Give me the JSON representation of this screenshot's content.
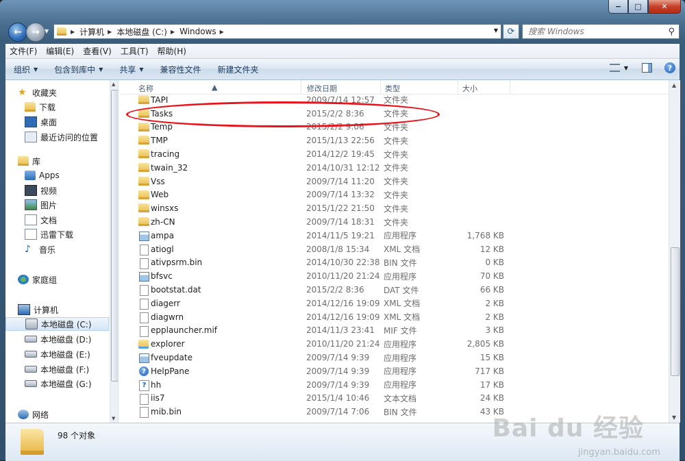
{
  "window": {
    "caption": {
      "minimize": "−",
      "maximize": "□",
      "close": "✕"
    }
  },
  "address": {
    "segments": [
      "计算机",
      "本地磁盘 (C:)",
      "Windows"
    ],
    "search_placeholder": "搜索 Windows"
  },
  "menu": [
    "文件(F)",
    "编辑(E)",
    "查看(V)",
    "工具(T)",
    "帮助(H)"
  ],
  "toolbar": {
    "organize": "组织",
    "include_library": "包含到库中",
    "share": "共享",
    "compat_files": "兼容性文件",
    "new_folder": "新建文件夹"
  },
  "columns": {
    "name": "名称",
    "date": "修改日期",
    "type": "类型",
    "size": "大小"
  },
  "nav": {
    "favorites": "收藏夹",
    "downloads": "下载",
    "desktop": "桌面",
    "recent": "最近访问的位置",
    "libraries": "库",
    "apps": "Apps",
    "videos": "视频",
    "pictures": "图片",
    "documents": "文档",
    "xunlei": "迅雷下载",
    "music": "音乐",
    "homegroup": "家庭组",
    "computer": "计算机",
    "drive_c": "本地磁盘 (C:)",
    "drive_d": "本地磁盘 (D:)",
    "drive_e": "本地磁盘 (E:)",
    "drive_f": "本地磁盘 (F:)",
    "drive_g": "本地磁盘 (G:)",
    "network": "网络"
  },
  "files": [
    {
      "name": "TAPI",
      "date": "2009/7/14 12:57",
      "type": "文件夹",
      "size": "",
      "icon": "folder"
    },
    {
      "name": "Tasks",
      "date": "2015/2/2 8:36",
      "type": "文件夹",
      "size": "",
      "icon": "folder"
    },
    {
      "name": "Temp",
      "date": "2015/2/2 9:06",
      "type": "文件夹",
      "size": "",
      "icon": "folder"
    },
    {
      "name": "TMP",
      "date": "2015/1/13 22:56",
      "type": "文件夹",
      "size": "",
      "icon": "folder"
    },
    {
      "name": "tracing",
      "date": "2014/12/2 19:45",
      "type": "文件夹",
      "size": "",
      "icon": "folder"
    },
    {
      "name": "twain_32",
      "date": "2014/10/31 12:12",
      "type": "文件夹",
      "size": "",
      "icon": "folder"
    },
    {
      "name": "Vss",
      "date": "2009/7/14 11:20",
      "type": "文件夹",
      "size": "",
      "icon": "folder"
    },
    {
      "name": "Web",
      "date": "2009/7/14 13:32",
      "type": "文件夹",
      "size": "",
      "icon": "folder"
    },
    {
      "name": "winsxs",
      "date": "2015/1/22 21:50",
      "type": "文件夹",
      "size": "",
      "icon": "folder"
    },
    {
      "name": "zh-CN",
      "date": "2009/7/14 18:31",
      "type": "文件夹",
      "size": "",
      "icon": "folder"
    },
    {
      "name": "ampa",
      "date": "2014/11/5 19:21",
      "type": "应用程序",
      "size": "1,768 KB",
      "icon": "exe"
    },
    {
      "name": "atiogl",
      "date": "2008/1/8 15:34",
      "type": "XML 文档",
      "size": "12 KB",
      "icon": "doc"
    },
    {
      "name": "ativpsrm.bin",
      "date": "2014/10/30 22:38",
      "type": "BIN 文件",
      "size": "0 KB",
      "icon": "doc"
    },
    {
      "name": "bfsvc",
      "date": "2010/11/20 21:24",
      "type": "应用程序",
      "size": "70 KB",
      "icon": "exe"
    },
    {
      "name": "bootstat.dat",
      "date": "2015/2/2 8:36",
      "type": "DAT 文件",
      "size": "66 KB",
      "icon": "doc"
    },
    {
      "name": "diagerr",
      "date": "2014/12/16 19:09",
      "type": "XML 文档",
      "size": "2 KB",
      "icon": "doc"
    },
    {
      "name": "diagwrn",
      "date": "2014/12/16 19:09",
      "type": "XML 文档",
      "size": "2 KB",
      "icon": "doc"
    },
    {
      "name": "epplauncher.mif",
      "date": "2014/11/3 23:41",
      "type": "MIF 文件",
      "size": "3 KB",
      "icon": "doc"
    },
    {
      "name": "explorer",
      "date": "2010/11/20 21:24",
      "type": "应用程序",
      "size": "2,805 KB",
      "icon": "explorer"
    },
    {
      "name": "fveupdate",
      "date": "2009/7/14 9:39",
      "type": "应用程序",
      "size": "15 KB",
      "icon": "exe"
    },
    {
      "name": "HelpPane",
      "date": "2009/7/14 9:39",
      "type": "应用程序",
      "size": "717 KB",
      "icon": "help"
    },
    {
      "name": "hh",
      "date": "2009/7/14 9:39",
      "type": "应用程序",
      "size": "17 KB",
      "icon": "hh"
    },
    {
      "name": "iis7",
      "date": "2015/1/4 10:46",
      "type": "文本文档",
      "size": "24 KB",
      "icon": "doc"
    },
    {
      "name": "mib.bin",
      "date": "2009/7/14 7:06",
      "type": "BIN 文件",
      "size": "43 KB",
      "icon": "doc"
    }
  ],
  "status": {
    "count": "98 个对象"
  },
  "watermark": {
    "text": "Bai du 经验",
    "url": "jingyan.baidu.com"
  },
  "colors": {
    "highlight_ring": "#e8141c",
    "accent": "#2d6cb8"
  }
}
